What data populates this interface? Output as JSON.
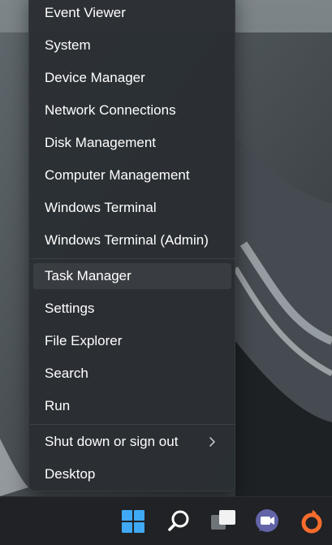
{
  "menu": {
    "group1": [
      "Event Viewer",
      "System",
      "Device Manager",
      "Network Connections",
      "Disk Management",
      "Computer Management",
      "Windows Terminal",
      "Windows Terminal (Admin)"
    ],
    "group2": [
      "Task Manager",
      "Settings",
      "File Explorer",
      "Search",
      "Run"
    ],
    "group3": [
      "Shut down or sign out",
      "Desktop"
    ],
    "highlighted_item": "Task Manager"
  },
  "taskbar": {
    "icons": [
      "windows-start-icon",
      "search-icon",
      "task-view-icon",
      "teams-chat-icon",
      "origin-icon"
    ]
  },
  "colors": {
    "menu_bg": "#2a2e33",
    "text": "#ffffff",
    "taskbar_bg": "#202225",
    "start_blue": "#3fa9f5",
    "teams_purple": "#6264a7",
    "origin_orange": "#f56c2d"
  }
}
